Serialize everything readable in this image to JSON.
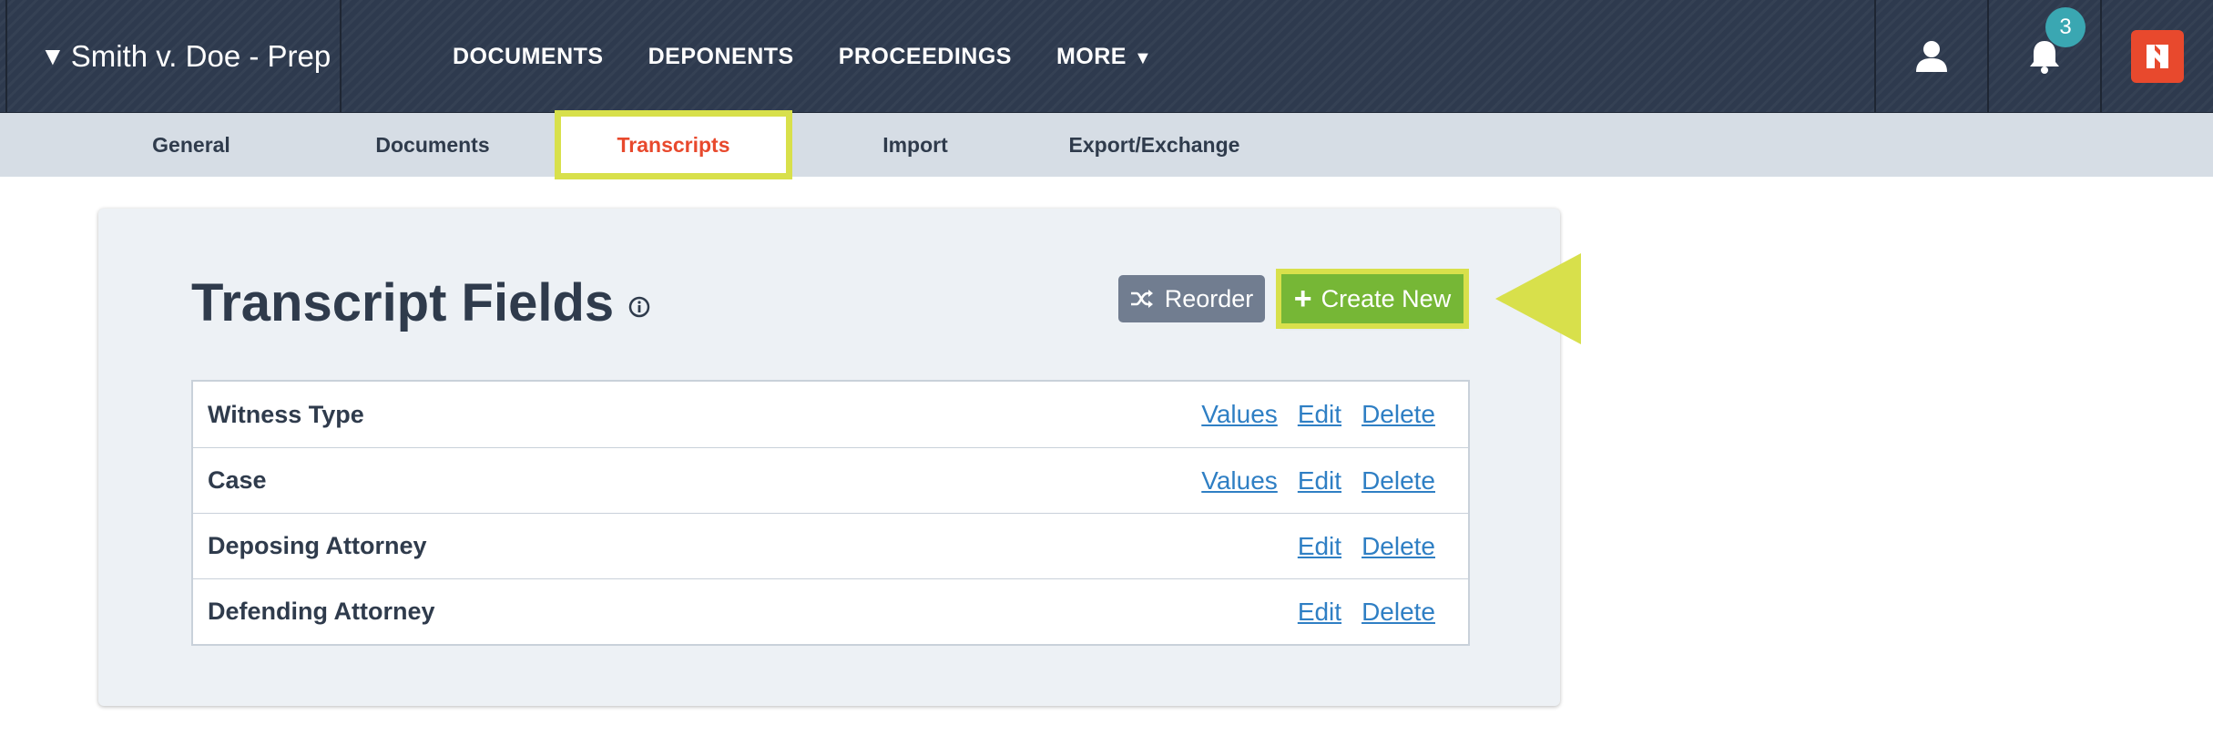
{
  "header": {
    "case_title": "Smith v. Doe - Prep",
    "nav": [
      {
        "label": "DOCUMENTS"
      },
      {
        "label": "DEPONENTS"
      },
      {
        "label": "PROCEEDINGS"
      },
      {
        "label": "MORE"
      }
    ],
    "more_arrow": "▼",
    "case_caret": "▼",
    "notification_count": "3"
  },
  "subnav": {
    "tabs": [
      {
        "label": "General"
      },
      {
        "label": "Documents"
      },
      {
        "label": "Transcripts"
      },
      {
        "label": "Import"
      },
      {
        "label": "Export/Exchange"
      }
    ],
    "active_tab": "Transcripts"
  },
  "main": {
    "title": "Transcript Fields",
    "reorder_label": "Reorder",
    "create_label": "Create New",
    "fields": [
      {
        "name": "Witness Type",
        "values": "Values",
        "edit": "Edit",
        "delete": "Delete"
      },
      {
        "name": "Case",
        "values": "Values",
        "edit": "Edit",
        "delete": "Delete"
      },
      {
        "name": "Deposing Attorney",
        "edit": "Edit",
        "delete": "Delete"
      },
      {
        "name": "Defending Attorney",
        "edit": "Edit",
        "delete": "Delete"
      }
    ]
  },
  "colors": {
    "topbar": "#2e3a4e",
    "accent_orange": "#e8492d",
    "create_green": "#76b736",
    "highlight_yellow": "#d8e04b",
    "link_blue": "#2f7fc4",
    "badge_teal": "#3aa7b2"
  },
  "icons": {
    "user": "user-icon",
    "bell": "bell-icon",
    "logo": "app-logo",
    "info": "info-icon",
    "shuffle": "shuffle-icon",
    "plus": "plus-icon"
  }
}
